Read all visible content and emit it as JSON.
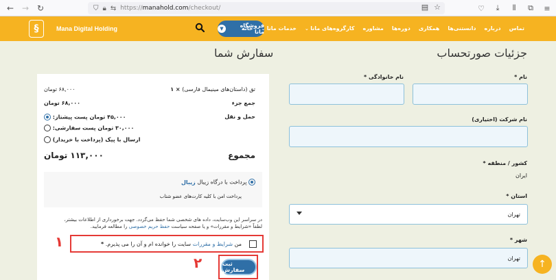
{
  "browser": {
    "url_scheme": "https://",
    "url_host": "manahold.com",
    "url_path": "/checkout/"
  },
  "header": {
    "brand": "Mana Digital Holding",
    "store_button": "فروشگاه مانا",
    "menu": [
      "خانه",
      "خدمات مانا",
      "کارگروه‌های مانا",
      "مشاوره",
      "دوره‌ها",
      "همکاری",
      "دانستنی‌ها",
      "درباره",
      "تماس"
    ]
  },
  "billing": {
    "title": "جزئیات صورتحساب",
    "first_name_label": "نام",
    "last_name_label": "نام خانوادگی",
    "company_label": "نام شرکت (اختیاری)",
    "country_label": "کشور / منطقه",
    "country_value": "ایران",
    "state_label": "استان",
    "state_value": "تهران",
    "city_label": "شهر",
    "city_value": "تهران",
    "required_mark": "*"
  },
  "order": {
    "title": "سفارش شما",
    "item_name": "تق (داستان‌های مینیمال فارسی)",
    "item_qty": "× ۱",
    "item_price": "۶۸,۰۰۰ تومان",
    "subtotal_label": "جمع جزء",
    "subtotal_value": "۶۸,۰۰۰ تومان",
    "shipping_label": "حمل و نقل",
    "shipping_options": [
      {
        "label": "پست پیشتاز:",
        "price": "۴۵,۰۰۰ تومان",
        "checked": true
      },
      {
        "label": "پست سفارشی:",
        "price": "۳۰,۰۰۰ تومان",
        "checked": false
      },
      {
        "label": "ارسال با پیک (پرداخت با خریدار)",
        "price": "",
        "checked": false
      }
    ],
    "total_label": "مجموع",
    "total_value": "۱۱۳,۰۰۰ تومان",
    "payment_label": "پرداخت با درگاه زیبال",
    "payment_logo": "زیبال",
    "payment_desc": "پرداخت امن با کلیه کارت‌های عضو شتاب",
    "privacy_1": "در سراسر این وب‌سایت، داده های شخصی شما حفظ می‌گردد. جهت برخورداری از اطلاعات بیشتر،",
    "privacy_2a": "لطفاً «شرایط و مقررات» و یا صفحه سیاست",
    "privacy_link": "حفظ حریم خصوصی",
    "privacy_2b": "را مطالعه فرمایید.",
    "terms_prefix": "من",
    "terms_link": "شرایط و مقررات",
    "terms_suffix": "سایت را خوانده ام و آن را می پذیرم.",
    "terms_req": "*",
    "submit_label": "ثبت سفارش"
  },
  "annotations": {
    "one": "۱",
    "two": "۲"
  }
}
